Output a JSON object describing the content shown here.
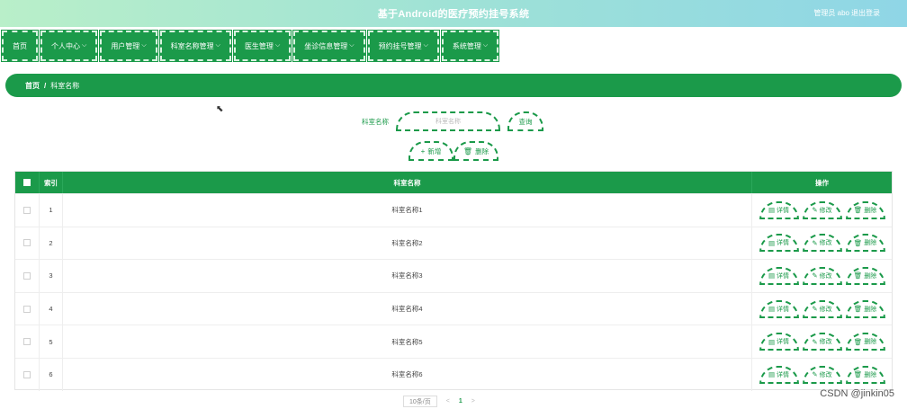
{
  "header": {
    "title": "基于Android的医疗预约挂号系统",
    "user": "管理员 abo",
    "logout": "退出登录"
  },
  "nav": [
    {
      "label": "首页",
      "has_menu": false
    },
    {
      "label": "个人中心",
      "has_menu": true
    },
    {
      "label": "用户管理",
      "has_menu": true
    },
    {
      "label": "科室名称管理",
      "has_menu": true
    },
    {
      "label": "医生管理",
      "has_menu": true
    },
    {
      "label": "坐诊信息管理",
      "has_menu": true
    },
    {
      "label": "预约挂号管理",
      "has_menu": true
    },
    {
      "label": "系统管理",
      "has_menu": true
    }
  ],
  "breadcrumb": {
    "home": "首页",
    "separator": "/",
    "current": "科室名称"
  },
  "search": {
    "label": "科室名称",
    "placeholder": "科室名称",
    "query_label": "查询"
  },
  "actions": {
    "add_label": "新增",
    "delete_label": "删除"
  },
  "table": {
    "headers": {
      "index": "索引",
      "name": "科室名称",
      "ops": "操作"
    },
    "rows": [
      {
        "index": "1",
        "name": "科室名称1"
      },
      {
        "index": "2",
        "name": "科室名称2"
      },
      {
        "index": "3",
        "name": "科室名称3"
      },
      {
        "index": "4",
        "name": "科室名称4"
      },
      {
        "index": "5",
        "name": "科室名称5"
      },
      {
        "index": "6",
        "name": "科室名称6"
      }
    ],
    "row_ops": {
      "detail": "详情",
      "edit": "修改",
      "delete": "删除"
    }
  },
  "pagination": {
    "page_size": "10条/页",
    "current_page": "1",
    "prev": "<",
    "next": ">"
  },
  "watermark": "CSDN @jinkin05",
  "colors": {
    "primary": "#1b9a4a",
    "header_gradient_start": "#b9efc9",
    "header_gradient_end": "#8fd6e6"
  }
}
